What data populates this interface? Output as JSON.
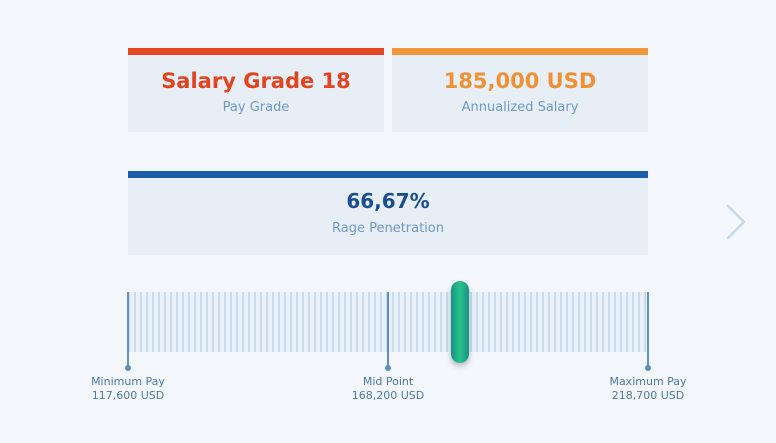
{
  "pay_grade": {
    "value": "Salary Grade 18",
    "label": "Pay Grade",
    "color": "#e64523"
  },
  "annualized_salary": {
    "value": "185,000 USD",
    "label": "Annualized Salary",
    "color": "#f0973a"
  },
  "range_penetration": {
    "value": "66,67%",
    "label": "Rage Penetration",
    "color": "#1b5ca9",
    "fraction": 0.6667
  },
  "salary_range": {
    "minimum": {
      "label": "Minimum Pay",
      "value": "117,600 USD"
    },
    "midpoint": {
      "label": "Mid Point",
      "value": "168,200 USD"
    },
    "maximum": {
      "label": "Maximum Pay",
      "value": "218,700 USD"
    },
    "handle_color": "#27c38a"
  },
  "navigation": {
    "next_icon": "chevron-right-icon"
  }
}
